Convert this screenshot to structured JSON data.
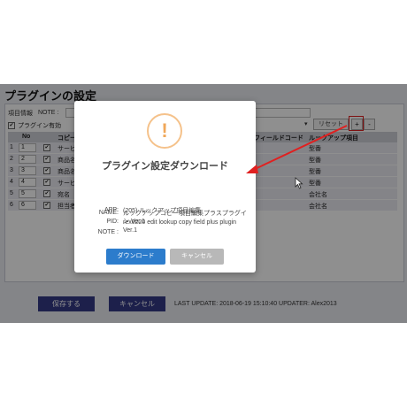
{
  "page": {
    "title": "プラグインの設定",
    "field_label": "項目情報",
    "note_label": "NOTE :",
    "enable_label": "プラグイン有効",
    "reset_label": "リセット",
    "add_symbol": "+",
    "remove_symbol": "-"
  },
  "table": {
    "headers": {
      "no": "No",
      "copy_source": "コピー",
      "field_code": "フィールドコード",
      "lookup": "ルックアップ項目"
    },
    "rows": [
      {
        "idx": "1",
        "no": "1",
        "checked": "✔",
        "source": "サービ",
        "dest": "型番"
      },
      {
        "idx": "2",
        "no": "2",
        "checked": "✔",
        "source": "商品名",
        "dest": "型番"
      },
      {
        "idx": "3",
        "no": "3",
        "checked": "✔",
        "source": "商品名",
        "dest": "型番"
      },
      {
        "idx": "4",
        "no": "4",
        "checked": "✔",
        "source": "サービ",
        "dest": "型番"
      },
      {
        "idx": "5",
        "no": "5",
        "checked": "✔",
        "source": "宛名",
        "dest": "会社名"
      },
      {
        "idx": "6",
        "no": "6",
        "checked": "✔",
        "source": "担当者",
        "dest": "会社名"
      }
    ]
  },
  "footer": {
    "save_label": "保存する",
    "cancel_label": "キャンセル",
    "last_update": "LAST UPDATE: 2018-06-19 15:10:40 UPDATER: Alex2013"
  },
  "dialog": {
    "icon_symbol": "!",
    "title": "プラグイン設定ダウンロード",
    "app_label": "APP:",
    "app_value": "(205) ルックアップ項目編集",
    "pid_label": "PID:",
    "pid_value": "rex0220 edit lookup copy field plus plugin Ver.1",
    "name_label": "NAME:",
    "name_value": "ルックアップコピー項目編集プラスプラグイン Ver.1",
    "note_label": "NOTE :",
    "note_value": "",
    "download_label": "ダウンロード",
    "cancel_label": "キャンセル"
  },
  "colors": {
    "primary_button": "#343a86",
    "download_button": "#2c7ccc",
    "warning_icon": "#f0a759",
    "annotation": "#e02020"
  },
  "icons": {
    "warning": "warning-icon",
    "cursor": "mouse-cursor-icon",
    "arrow": "red-annotation-arrow"
  }
}
